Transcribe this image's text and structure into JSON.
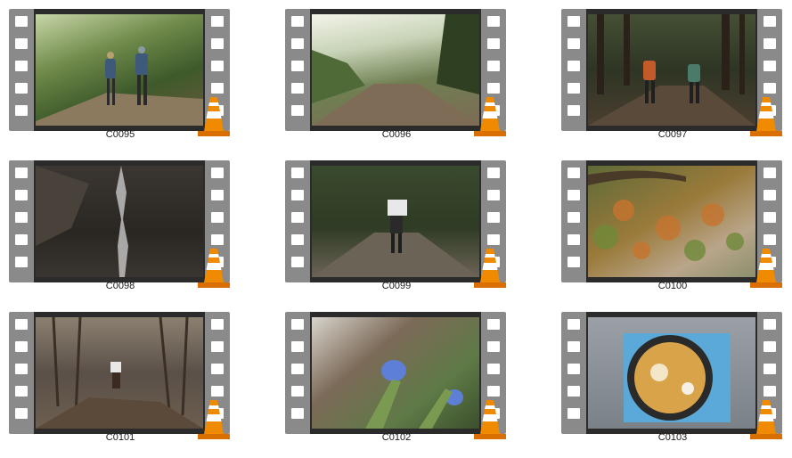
{
  "items": [
    {
      "label": "C0095"
    },
    {
      "label": "C0096"
    },
    {
      "label": "C0097"
    },
    {
      "label": "C0098"
    },
    {
      "label": "C0099"
    },
    {
      "label": "C0100"
    },
    {
      "label": "C0101"
    },
    {
      "label": "C0102"
    },
    {
      "label": "C0103"
    }
  ],
  "colors": {
    "film_strip": "#8a8a8a",
    "sprocket_hole": "#ffffff",
    "vlc_orange": "#f08a00",
    "label_text": "#1b1b1b"
  },
  "icons": {
    "file_type": "vlc-cone-icon",
    "thumbnail_frame": "film-strip-icon"
  }
}
